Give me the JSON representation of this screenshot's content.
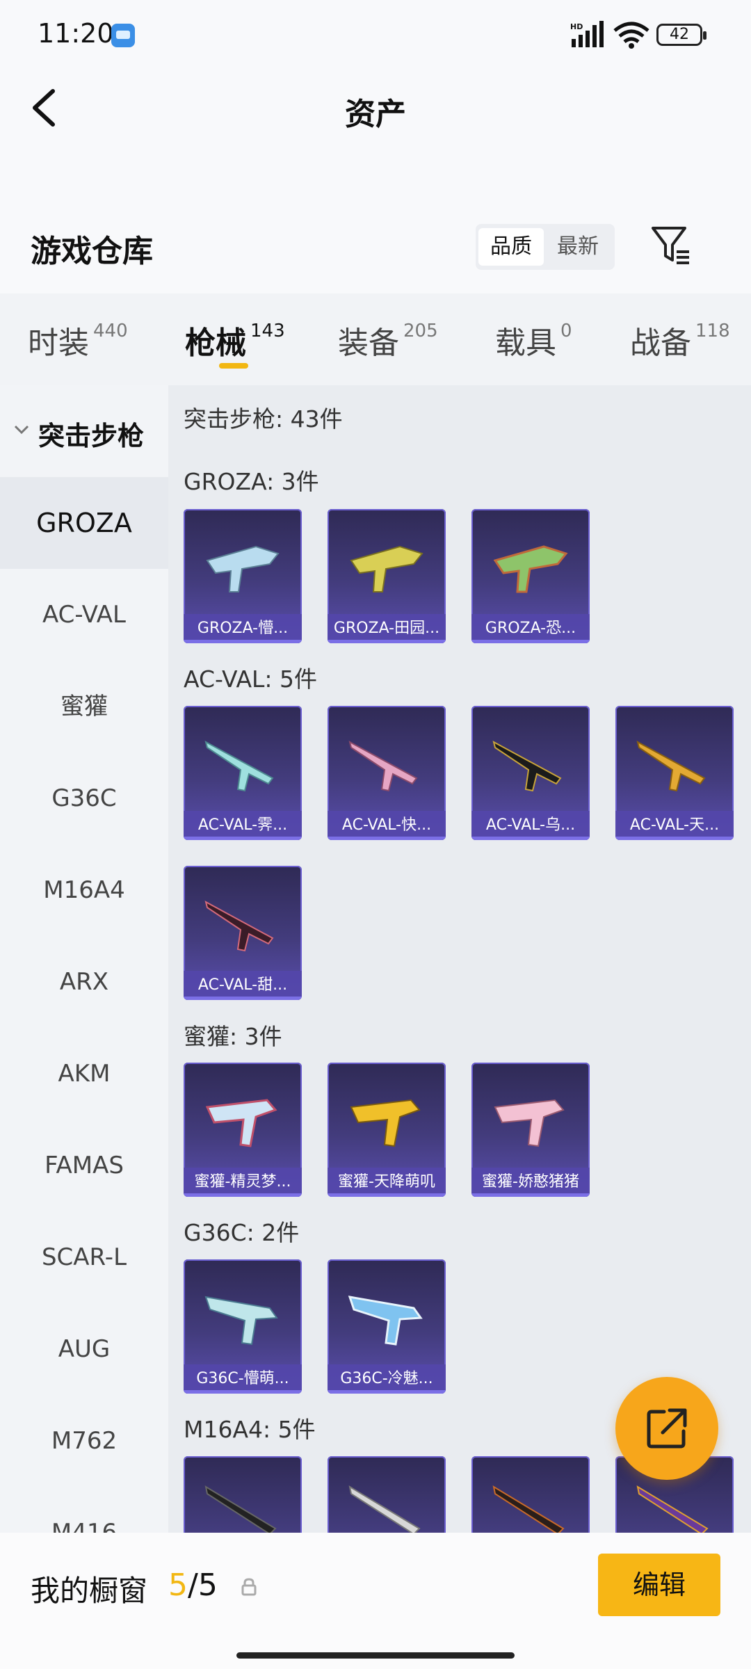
{
  "status_bar": {
    "time": "11:20",
    "battery": "42"
  },
  "header": {
    "title": "资产"
  },
  "warehouse_title": "游戏仓库",
  "sort_options": [
    "品质",
    "最新"
  ],
  "tabs": [
    {
      "label": "时装",
      "count": "440"
    },
    {
      "label": "枪械",
      "count": "143"
    },
    {
      "label": "装备",
      "count": "205"
    },
    {
      "label": "载具",
      "count": "0"
    },
    {
      "label": "战备",
      "count": "118"
    }
  ],
  "sidebar": {
    "category": "突击步枪",
    "items": [
      "GROZA",
      "AC-VAL",
      "蜜獾",
      "G36C",
      "M16A4",
      "ARX",
      "AKM",
      "FAMAS",
      "SCAR-L",
      "AUG",
      "M762",
      "M416"
    ]
  },
  "main": {
    "category_summary": "突击步枪: 43件",
    "sections": [
      {
        "header": "GROZA: 3件",
        "items": [
          "GROZA-懵...",
          "GROZA-田园...",
          "GROZA-恐..."
        ]
      },
      {
        "header": "AC-VAL: 5件",
        "items": [
          "AC-VAL-霁...",
          "AC-VAL-快...",
          "AC-VAL-乌...",
          "AC-VAL-天...",
          "AC-VAL-甜..."
        ]
      },
      {
        "header": "蜜獾: 3件",
        "items": [
          "蜜獾-精灵梦...",
          "蜜獾-天降萌叽",
          "蜜獾-娇憨猪猪"
        ]
      },
      {
        "header": "G36C: 2件",
        "items": [
          "G36C-懵萌...",
          "G36C-冷魅..."
        ]
      },
      {
        "header": "M16A4: 5件",
        "items": [
          "",
          "",
          "",
          ""
        ]
      }
    ]
  },
  "bottom_bar": {
    "label": "我的橱窗",
    "current": "5",
    "total": "/5",
    "edit_label": "编辑"
  },
  "colors": {
    "accent": "#f2b713",
    "fab": "#f7a61b",
    "card": "#433c7d"
  },
  "icons": [
    "back-arrow-icon",
    "filter-icon",
    "chevron-down-icon",
    "share-icon",
    "lock-icon"
  ]
}
